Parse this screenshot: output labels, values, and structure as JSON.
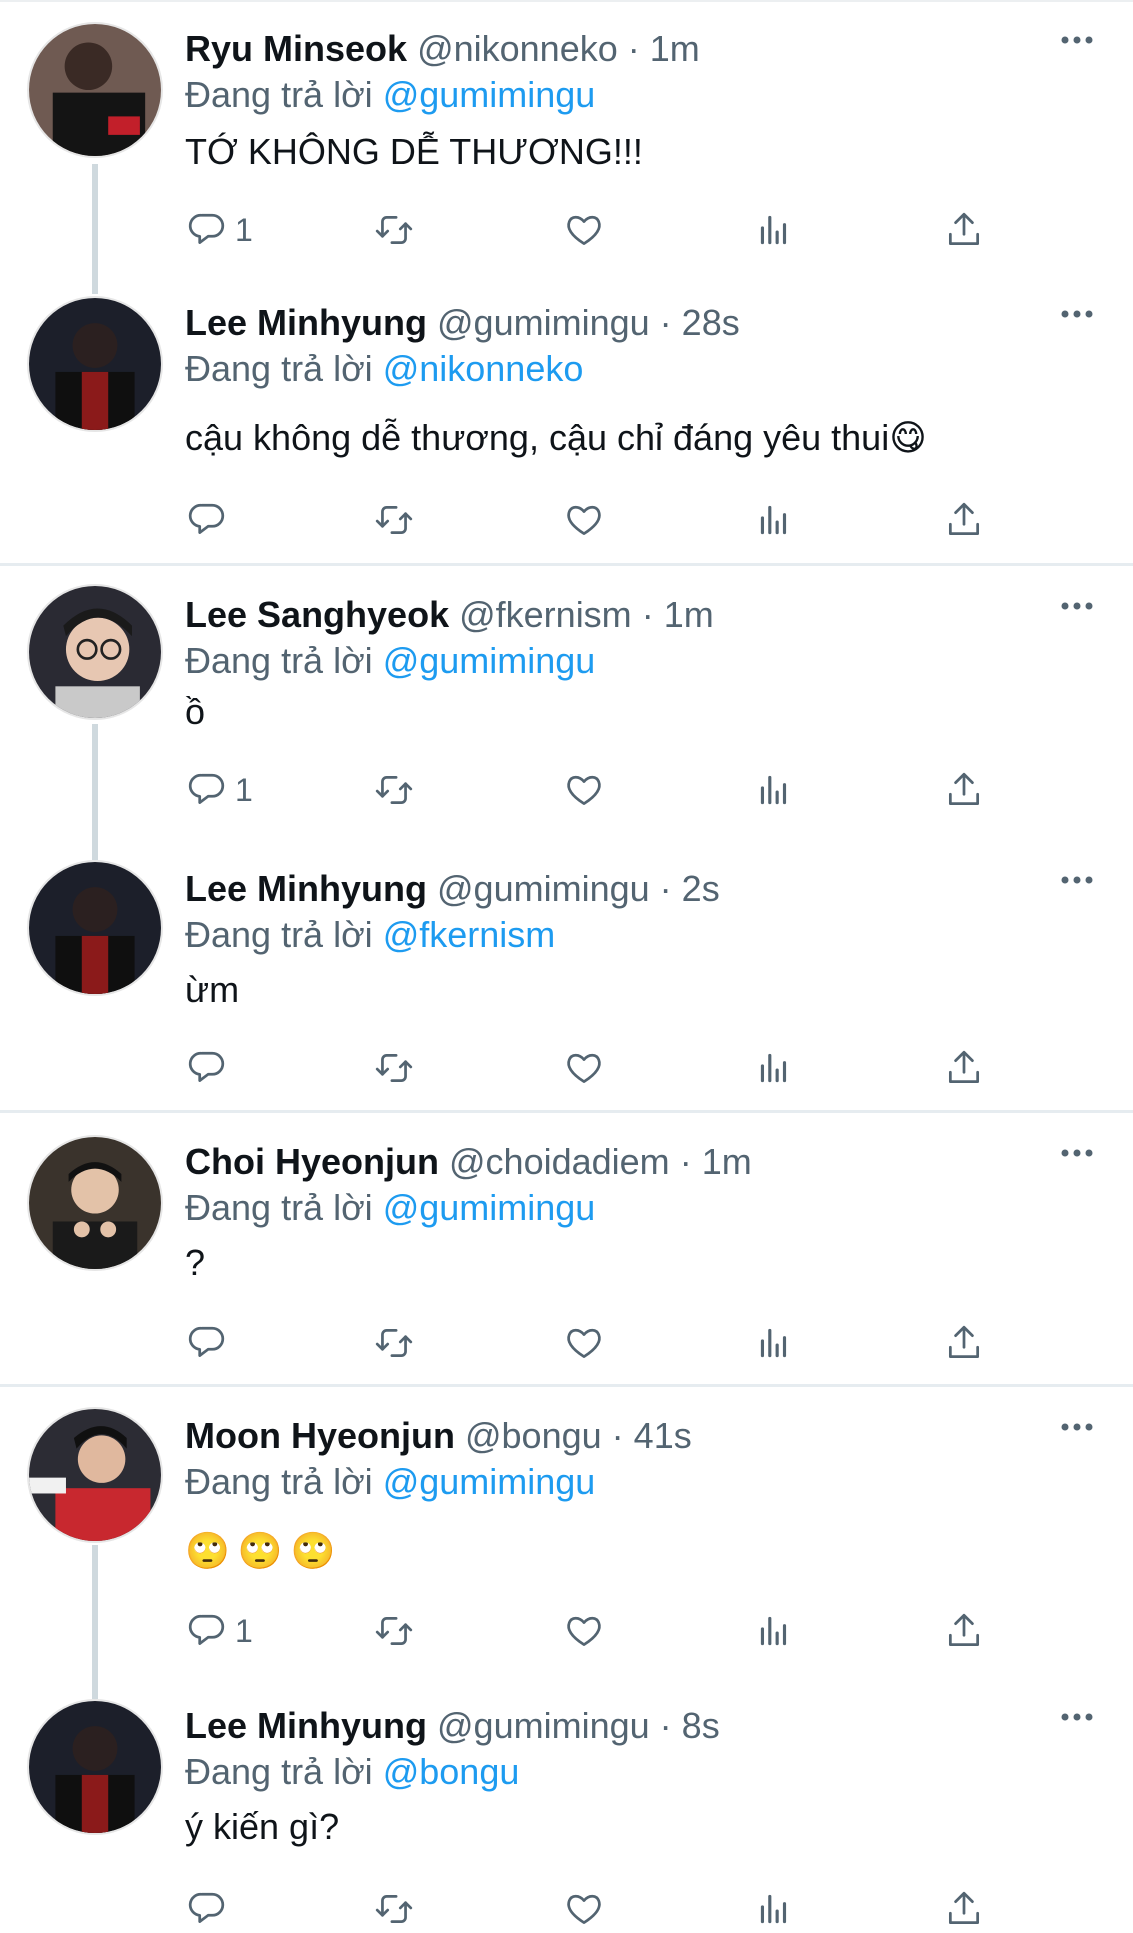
{
  "tweets": [
    {
      "name": "Ryu Minseok",
      "handle": "@nikonneko",
      "time": "1m",
      "reply_prefix": "Đang trả lời",
      "reply_to": "@gumimingu",
      "text": "TỚ KHÔNG DỄ THƯƠNG!!!",
      "reply_count": "1"
    },
    {
      "name": "Lee Minhyung",
      "handle": "@gumimingu",
      "time": "28s",
      "reply_prefix": "Đang trả lời",
      "reply_to": "@nikonneko",
      "text": "cậu không dễ thương, cậu chỉ đáng yêu thui😋",
      "reply_count": ""
    },
    {
      "name": "Lee Sanghyeok",
      "handle": "@fkernism",
      "time": "1m",
      "reply_prefix": "Đang trả lời",
      "reply_to": "@gumimingu",
      "text": "ồ",
      "reply_count": "1"
    },
    {
      "name": "Lee Minhyung",
      "handle": "@gumimingu",
      "time": "2s",
      "reply_prefix": "Đang trả lời",
      "reply_to": "@fkernism",
      "text": "ừm",
      "reply_count": ""
    },
    {
      "name": "Choi Hyeonjun",
      "handle": "@choidadiem",
      "time": "1m",
      "reply_prefix": "Đang trả lời",
      "reply_to": "@gumimingu",
      "text": "?",
      "reply_count": ""
    },
    {
      "name": "Moon Hyeonjun",
      "handle": "@bongu",
      "time": "41s",
      "reply_prefix": "Đang trả lời",
      "reply_to": "@gumimingu",
      "text": "🙄🙄🙄",
      "reply_count": "1"
    },
    {
      "name": "Lee Minhyung",
      "handle": "@gumimingu",
      "time": "8s",
      "reply_prefix": "Đang trả lời",
      "reply_to": "@bongu",
      "text": "ý kiến gì?",
      "reply_count": ""
    }
  ],
  "separator": "·",
  "icons": {
    "reply": "reply-icon",
    "retweet": "retweet-icon",
    "like": "heart-icon",
    "analytics": "analytics-icon",
    "share": "share-icon",
    "more": "more-icon"
  },
  "colors": {
    "accent": "#1d9bf0",
    "secondary_text": "#536471",
    "thread_line": "#cfd9de"
  }
}
